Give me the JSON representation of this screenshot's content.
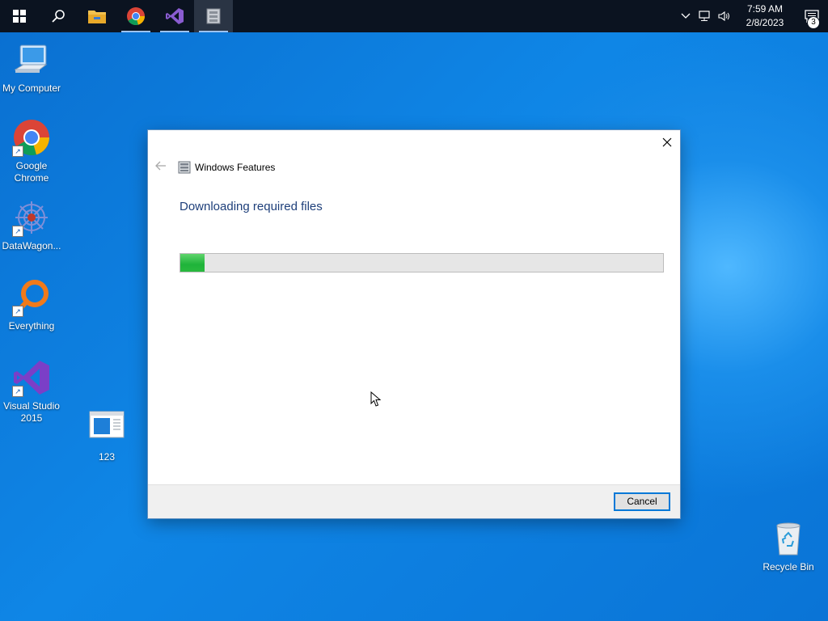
{
  "taskbar": {
    "start_icon": "windows-logo-icon",
    "search_icon": "search-icon",
    "pinned": [
      {
        "name": "file-explorer-icon"
      },
      {
        "name": "chrome-icon"
      },
      {
        "name": "visual-studio-icon"
      },
      {
        "name": "windows-features-icon"
      }
    ],
    "clock": {
      "time": "7:59 AM",
      "date": "2/8/2023"
    },
    "notification_count": "3"
  },
  "desktop": {
    "icons": [
      {
        "label": "My Computer",
        "icon": "computer-icon"
      },
      {
        "label": "Google Chrome",
        "icon": "chrome-icon"
      },
      {
        "label": "DataWagon...",
        "icon": "datawagon-icon"
      },
      {
        "label": "Everything",
        "icon": "everything-search-icon"
      },
      {
        "label": "Visual Studio 2015",
        "icon": "visual-studio-icon"
      },
      {
        "label": "123",
        "icon": "document-icon"
      },
      {
        "label": "Recycle Bin",
        "icon": "recycle-bin-icon"
      }
    ]
  },
  "dialog": {
    "title": "Windows Features",
    "heading": "Downloading required files",
    "progress_percent": 5,
    "cancel_label": "Cancel"
  },
  "colors": {
    "accent": "#0078d7",
    "progress": "#29b93e",
    "heading": "#1e3f7a"
  }
}
